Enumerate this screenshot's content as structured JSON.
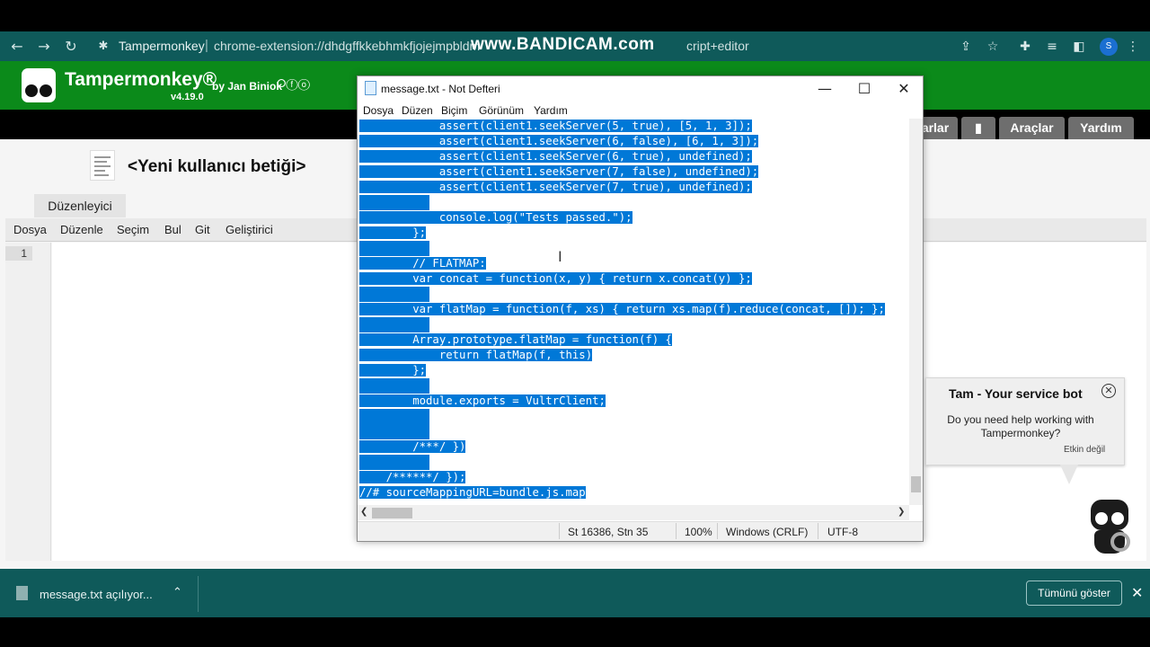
{
  "browser": {
    "site_name": "Tampermonkey",
    "url_separator": "|",
    "url_start": "chrome-extension://dhdgffkkebhmkfjojejmpbldm",
    "url_end": "cript+editor",
    "watermark": "www.BANDICAM.com",
    "profile_initial": "S",
    "icons": [
      "back-icon",
      "forward-icon",
      "reload-icon",
      "extension-icon",
      "share-icon",
      "star-icon",
      "puzzle-icon",
      "playlist-icon",
      "sidepanel-icon",
      "kebab-menu-icon"
    ]
  },
  "tampermonkey": {
    "brand": "Tampermonkey®",
    "by": "by Jan Biniok",
    "social": "⭘ⓕⓞ",
    "version": "v4.19.0",
    "tabs": [
      {
        "label": "arlar"
      },
      {
        "label": ""
      },
      {
        "label": "Araçlar"
      },
      {
        "label": "Yardım"
      }
    ]
  },
  "editor": {
    "script_title": "<Yeni kullanıcı betiği>",
    "edit_tab": "Düzenleyici",
    "menu": [
      "Dosya",
      "Düzenle",
      "Seçim",
      "Bul",
      "Git",
      "Geliştirici"
    ],
    "line_number": "1"
  },
  "notepad": {
    "title": "message.txt - Not Defteri",
    "win_controls": [
      "—",
      "☐",
      "✕"
    ],
    "menu": [
      "Dosya",
      "Düzen",
      "Biçim",
      "Görünüm",
      "Yardım"
    ],
    "lines": [
      "            assert(client1.seekServer(5, true), [5, 1, 3]);",
      "            assert(client1.seekServer(6, false), [6, 1, 3]);",
      "            assert(client1.seekServer(6, true), undefined);",
      "            assert(client1.seekServer(7, false), undefined);",
      "            assert(client1.seekServer(7, true), undefined);",
      "",
      "            console.log(\"Tests passed.\");",
      "        };",
      "",
      "        // FLATMAP:",
      "        var concat = function(x, y) { return x.concat(y) };",
      "",
      "        var flatMap = function(f, xs) { return xs.map(f).reduce(concat, []); };",
      "",
      "        Array.prototype.flatMap = function(f) {",
      "            return flatMap(f, this)",
      "        };",
      "",
      "        module.exports = VultrClient;",
      "",
      "",
      "        /***/ })",
      "",
      "    /******/ });",
      "//# sourceMappingURL=bundle.js.map"
    ],
    "status": {
      "position": "St 16386, Stn 35",
      "zoom": "100%",
      "line_ending": "Windows (CRLF)",
      "encoding": "UTF-8"
    }
  },
  "bot": {
    "title": "Tam - Your service bot",
    "message": "Do you need help working with Tampermonkey?",
    "action": "Etkin değil"
  },
  "downloads": {
    "file": "message.txt açılıyor...",
    "show_all": "Tümünü göster"
  }
}
